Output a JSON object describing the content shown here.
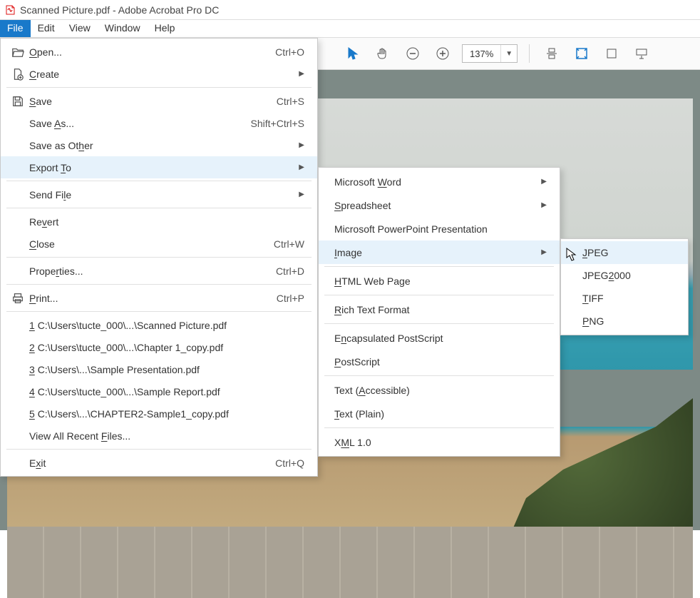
{
  "window": {
    "title": "Scanned Picture.pdf - Adobe Acrobat Pro DC"
  },
  "menubar": {
    "items": [
      "File",
      "Edit",
      "View",
      "Window",
      "Help"
    ]
  },
  "toolbar": {
    "zoom": "137%"
  },
  "file_menu": {
    "open": {
      "label": "Open...",
      "u": "O",
      "accel": "Ctrl+O"
    },
    "create": {
      "label": "Create",
      "u": "C"
    },
    "save": {
      "label": "Save",
      "u": "S",
      "accel": "Ctrl+S"
    },
    "save_as": {
      "label": "Save As...",
      "u": "A",
      "accel": "Shift+Ctrl+S"
    },
    "save_other": {
      "label": "Save as Other",
      "u": "h"
    },
    "export_to": {
      "label": "Export To",
      "u": "T"
    },
    "send_file": {
      "label": "Send File",
      "u": "l"
    },
    "revert": {
      "label": "Revert",
      "u": "v"
    },
    "close": {
      "label": "Close",
      "u": "C",
      "accel": "Ctrl+W"
    },
    "properties": {
      "label": "Properties...",
      "u": "r",
      "accel": "Ctrl+D"
    },
    "print": {
      "label": "Print...",
      "u": "P",
      "accel": "Ctrl+P"
    },
    "recent": [
      {
        "n": "1",
        "label": "C:\\Users\\tucte_000\\...\\Scanned Picture.pdf"
      },
      {
        "n": "2",
        "label": "C:\\Users\\tucte_000\\...\\Chapter 1_copy.pdf"
      },
      {
        "n": "3",
        "label": "C:\\Users\\...\\Sample Presentation.pdf"
      },
      {
        "n": "4",
        "label": "C:\\Users\\tucte_000\\...\\Sample Report.pdf"
      },
      {
        "n": "5",
        "label": "C:\\Users\\...\\CHAPTER2-Sample1_copy.pdf"
      }
    ],
    "view_all_recent": {
      "label": "View All Recent Files...",
      "u": "F"
    },
    "exit": {
      "label": "Exit",
      "u": "x",
      "accel": "Ctrl+Q"
    }
  },
  "export_menu": {
    "word": {
      "label": "Microsoft Word",
      "u": "W"
    },
    "spreadsheet": {
      "label": "Spreadsheet",
      "u": "S"
    },
    "ppt": {
      "label": "Microsoft PowerPoint Presentation",
      "u": ""
    },
    "image": {
      "label": "Image",
      "u": "I"
    },
    "html": {
      "label": "HTML Web Page",
      "u": "H"
    },
    "rtf": {
      "label": "Rich Text Format",
      "u": "R"
    },
    "eps": {
      "label": "Encapsulated PostScript",
      "u": "n"
    },
    "ps": {
      "label": "PostScript",
      "u": "P"
    },
    "text_a": {
      "label": "Text (Accessible)",
      "u": "A"
    },
    "text_p": {
      "label": "Text (Plain)",
      "u": "T"
    },
    "xml": {
      "label": "XML 1.0",
      "u": "M"
    }
  },
  "image_menu": {
    "jpeg": {
      "label": "JPEG",
      "u": "J"
    },
    "jpeg2000": {
      "label": "JPEG2000",
      "u": "2"
    },
    "tiff": {
      "label": "TIFF",
      "u": "T"
    },
    "png": {
      "label": "PNG",
      "u": "P"
    }
  }
}
